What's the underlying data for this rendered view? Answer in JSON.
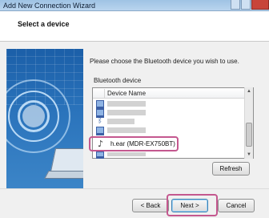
{
  "window": {
    "title": "Add New Connection Wizard"
  },
  "header": {
    "heading": "Select a device"
  },
  "main": {
    "prompt": "Please choose the Bluetooth device you wish to use.",
    "device_group_label": "Bluetooth device",
    "list": {
      "column_header": "Device Name",
      "items": [
        {
          "icon": "computer-icon",
          "label": ""
        },
        {
          "icon": "computer-icon",
          "label": ""
        },
        {
          "icon": "bluetooth-device-icon",
          "label": ""
        },
        {
          "icon": "computer-icon",
          "label": ""
        },
        {
          "icon": "headphones-icon",
          "label": "h.ear (MDR-EX750BT)",
          "selected": true
        },
        {
          "icon": "computer-icon",
          "label": ""
        }
      ]
    },
    "refresh_label": "Refresh"
  },
  "footer": {
    "back_label": "< Back",
    "next_label": "Next >",
    "cancel_label": "Cancel"
  },
  "colors": {
    "highlight": "#c4588f",
    "banner_blue": "#2b74bc"
  }
}
